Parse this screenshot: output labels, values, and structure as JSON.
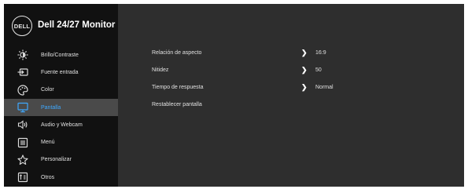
{
  "header": {
    "logo_text": "DELL",
    "title": "Dell 24/27 Monitor"
  },
  "sidebar": {
    "items": [
      {
        "label": "Brillo/Contraste",
        "icon": "brightness-icon",
        "active": false
      },
      {
        "label": "Fuente entrada",
        "icon": "input-source-icon",
        "active": false
      },
      {
        "label": "Color",
        "icon": "color-palette-icon",
        "active": false
      },
      {
        "label": "Pantalla",
        "icon": "display-monitor-icon",
        "active": true
      },
      {
        "label": "Audio y Webcam",
        "icon": "speaker-icon",
        "active": false
      },
      {
        "label": "Menú",
        "icon": "menu-icon",
        "active": false
      },
      {
        "label": "Personalizar",
        "icon": "star-icon",
        "active": false
      },
      {
        "label": "Otros",
        "icon": "others-icon",
        "active": false
      }
    ]
  },
  "settings": [
    {
      "label": "Relación de aspecto",
      "value": "16:9"
    },
    {
      "label": "Nitidez",
      "value": "50"
    },
    {
      "label": "Tiempo de respuesta",
      "value": "Normal"
    },
    {
      "label": "Restablecer pantalla",
      "value": ""
    }
  ],
  "colors": {
    "background": "#2e2e2e",
    "sidebar": "#111111",
    "active_bg": "#4a4a4a",
    "accent": "#3fa9ff"
  }
}
